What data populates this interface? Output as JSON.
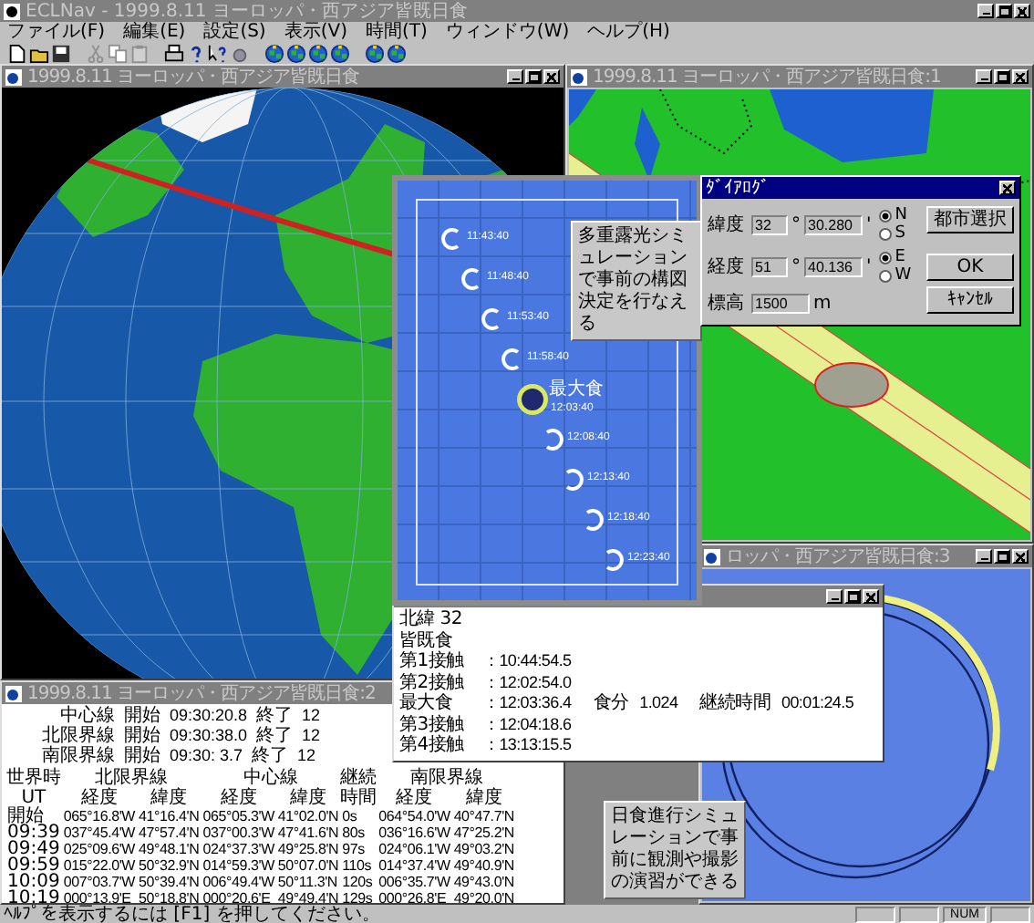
{
  "app": {
    "title": "ECLNav - 1999.8.11 ヨーロッパ・西アジア皆既日食"
  },
  "menu": [
    "ファイル(F)",
    "編集(E)",
    "設定(S)",
    "表示(V)",
    "時間(T)",
    "ウィンドウ(W)",
    "ヘルプ(H)"
  ],
  "globe_window": {
    "title": "1999.8.11 ヨーロッパ・西アジア皆既日食"
  },
  "map_window": {
    "title": "1999.8.11 ヨーロッパ・西アジア皆既日食:1"
  },
  "dialog": {
    "title": "ﾀﾞｲｱﾛｸﾞ",
    "fields": [
      {
        "label": "緯度",
        "degrees": "32",
        "degree_unit": "°",
        "minutes": "30.280",
        "minute_unit": "'",
        "options": [
          {
            "label": "N",
            "selected": true
          },
          {
            "label": "S",
            "selected": false
          }
        ]
      },
      {
        "label": "経度",
        "degrees": "51",
        "degree_unit": "°",
        "minutes": "40.136",
        "minute_unit": "'",
        "options": [
          {
            "label": "E",
            "selected": true
          },
          {
            "label": "W",
            "selected": false
          }
        ]
      }
    ],
    "elevation": {
      "label": "標高",
      "value": "1500",
      "unit": "m"
    },
    "buttons": [
      "都市選択",
      "OK",
      "ｷｬﾝｾﾙ"
    ]
  },
  "simulation": {
    "frames": [
      {
        "kind": "crescent",
        "time": "11:43:40"
      },
      {
        "kind": "crescent",
        "time": "11:48:40"
      },
      {
        "kind": "crescent",
        "time": "11:53:40"
      },
      {
        "kind": "crescent",
        "time": "11:58:40"
      },
      {
        "kind": "totality",
        "label": "最大食",
        "time": "12:03:40"
      },
      {
        "kind": "crescent",
        "time": "12:08:40"
      },
      {
        "kind": "crescent",
        "time": "12:13:40"
      },
      {
        "kind": "crescent",
        "time": "12:18:40"
      },
      {
        "kind": "crescent",
        "time": "12:23:40"
      }
    ],
    "callout": "多重露光シミュレーションで事前の構図決定を行なえる"
  },
  "info_window": {
    "latitude": "北緯 32",
    "eclipse_type": "皆既食",
    "contacts": [
      {
        "label": "第1接触",
        "value": "：10:44:54.5"
      },
      {
        "label": "第2接触",
        "value": "：12:02:54.0"
      },
      {
        "label": "最大食",
        "value": "：12:03:36.4",
        "extras": [
          {
            "label": "食分",
            "value": "1.024"
          },
          {
            "label": "継続時間",
            "value": "00:01:24.5"
          }
        ]
      },
      {
        "label": "第3接触",
        "value": "：12:04:18.6"
      },
      {
        "label": "第4接触",
        "value": "：13:13:15.5"
      }
    ]
  },
  "table_window": {
    "title": "1999.8.11 ヨーロッパ・西アジア皆既日食:2",
    "summary": [
      {
        "line": "中心線",
        "start_label": "開始",
        "start": "09:30:20.8",
        "end_label": "終了",
        "end": "12"
      },
      {
        "line": "北限界線",
        "start_label": "開始",
        "start": "09:30:38.0",
        "end_label": "終了",
        "end": "12"
      },
      {
        "line": "南限界線",
        "start_label": "開始",
        "start": "09:30: 3.7",
        "end_label": "終了",
        "end": "12"
      }
    ],
    "column_groups": [
      {
        "label": "世界時",
        "columns": [
          "UT"
        ]
      },
      {
        "label": "北限界線",
        "columns": [
          "経度",
          "緯度"
        ]
      },
      {
        "label": "中心線",
        "columns": [
          "経度",
          "緯度"
        ]
      },
      {
        "label": "継続",
        "columns": [
          "時間"
        ]
      },
      {
        "label": "南限界線",
        "columns": [
          "経度",
          "緯度"
        ]
      }
    ],
    "rows": [
      [
        "開始",
        "065°16.8'W",
        "41°16.4'N",
        "065°05.3'W",
        "41°02.0'N",
        "0s",
        "064°54.0'W",
        "40°47.7'N"
      ],
      [
        "09:39",
        "037°45.4'W",
        "47°57.4'N",
        "037°00.3'W",
        "47°41.6'N",
        "80s",
        "036°16.6'W",
        "47°25.2'N"
      ],
      [
        "09:49",
        "025°09.6'W",
        "49°48.1'N",
        "024°37.3'W",
        "49°25.8'N",
        "97s",
        "024°06.1'W",
        "49°03.2'N"
      ],
      [
        "09:59",
        "015°22.0'W",
        "50°32.9'N",
        "014°59.3'W",
        "50°07.0'N",
        "110s",
        "014°37.4'W",
        "49°40.9'N"
      ],
      [
        "10:09",
        "007°03.7'W",
        "50°39.4'N",
        "006°49.4'W",
        "50°11.3'N",
        "120s",
        "006°35.7'W",
        "49°43.0'N"
      ],
      [
        "10:19",
        "000°13.9'E",
        "50°18.8'N",
        "000°20.6'E",
        "49°49.4'N",
        "129s",
        "000°26.8'E",
        "49°20.0'N"
      ]
    ]
  },
  "sun_window": {
    "title": "ロッパ・西アジア皆既日食:3",
    "callout": "日食進行シミュレーションで事前に観測や撮影の演習ができる"
  },
  "status_bar": {
    "hint": "ﾍﾙﾌﾟを表示するには [F1] を押してください。",
    "indicator": "NUM"
  }
}
